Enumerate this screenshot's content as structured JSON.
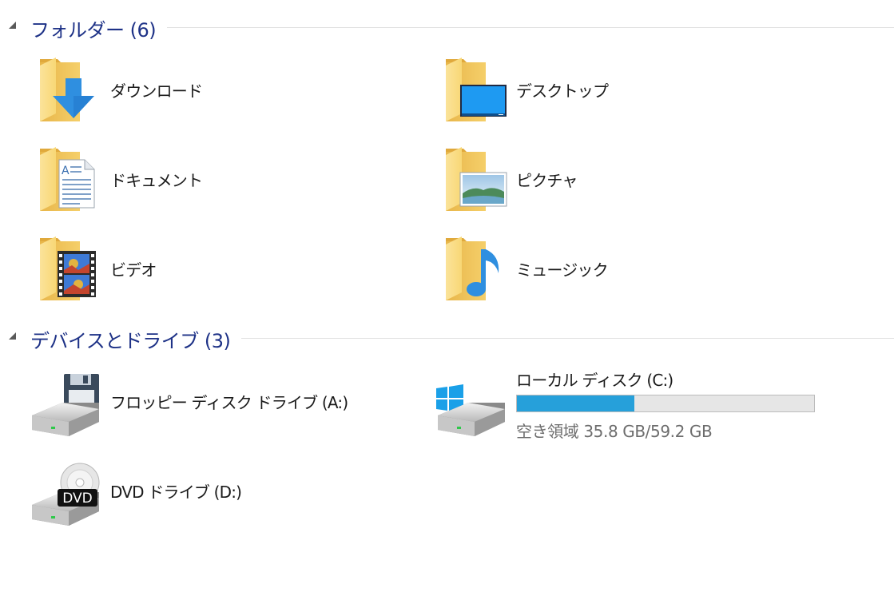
{
  "groups": {
    "folders": {
      "title": "フォルダー (6)",
      "items": [
        {
          "label": "ダウンロード",
          "icon": "download-folder-icon"
        },
        {
          "label": "デスクトップ",
          "icon": "desktop-folder-icon"
        },
        {
          "label": "ドキュメント",
          "icon": "documents-folder-icon"
        },
        {
          "label": "ピクチャ",
          "icon": "pictures-folder-icon"
        },
        {
          "label": "ビデオ",
          "icon": "videos-folder-icon"
        },
        {
          "label": "ミュージック",
          "icon": "music-folder-icon"
        }
      ]
    },
    "devices": {
      "title": "デバイスとドライブ (3)",
      "items": [
        {
          "label": "フロッピー ディスク ドライブ (A:)",
          "icon": "floppy-drive-icon"
        },
        {
          "label": "ローカル ディスク (C:)",
          "icon": "local-disk-icon",
          "used_fraction": 0.395,
          "free_text": "空き領域 35.8 GB/59.2 GB"
        },
        {
          "label": "DVD ドライブ (D:)",
          "icon": "dvd-drive-icon",
          "badge": "DVD"
        }
      ]
    }
  },
  "colors": {
    "group_title": "#1e3287",
    "capacity_fill": "#26a0da",
    "folder_yellow": "#f8d775"
  }
}
